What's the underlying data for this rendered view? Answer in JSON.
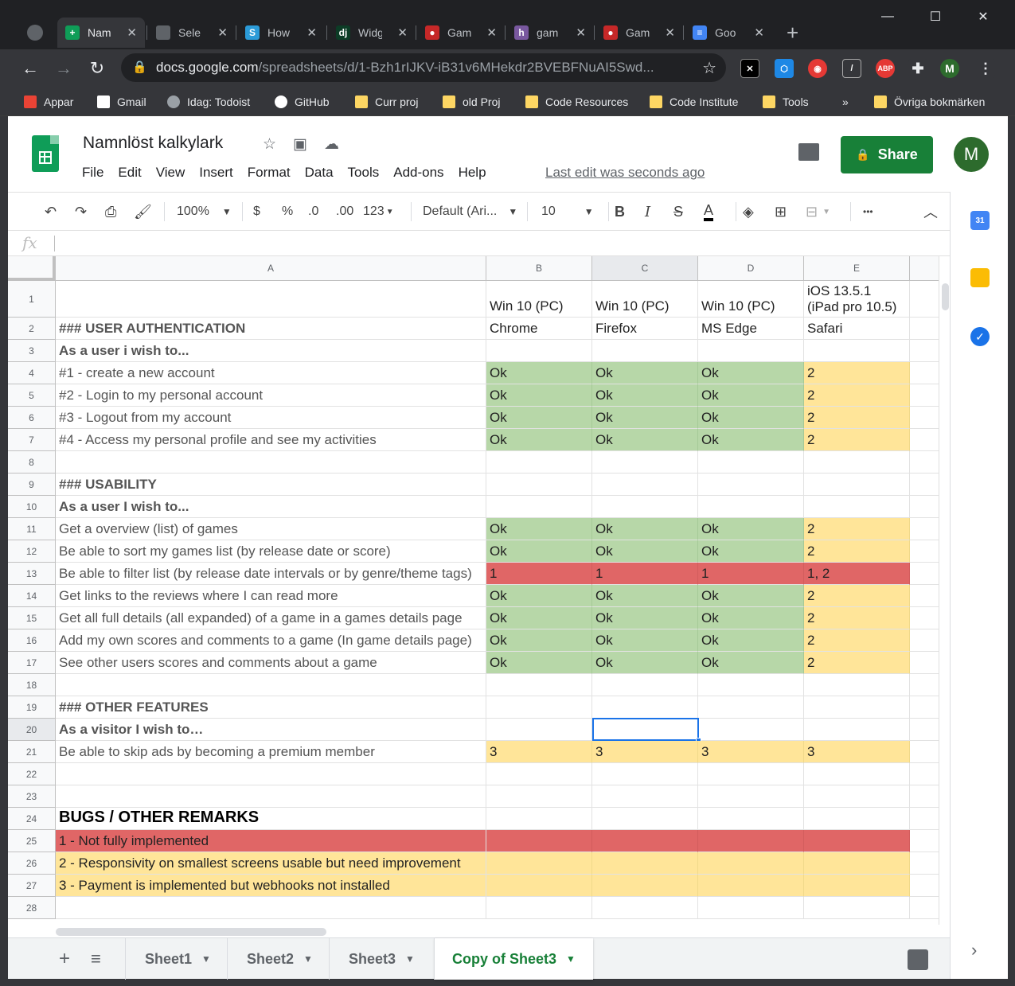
{
  "browser": {
    "tabs": [
      {
        "title": "Nam",
        "fav": "sheets-favicon-icon",
        "color": "#0f9d58",
        "glyph": "+"
      },
      {
        "title": "Sele",
        "fav": "globe-favicon-icon",
        "color": "#5f6368",
        "glyph": ""
      },
      {
        "title": "How",
        "fav": "s-favicon-icon",
        "color": "#2b9bd8",
        "glyph": "S"
      },
      {
        "title": "Widg",
        "fav": "django-favicon-icon",
        "color": "#0c3c26",
        "glyph": "dj"
      },
      {
        "title": "Gam",
        "fav": "pokeball-favicon-icon",
        "color": "#c62828",
        "glyph": "●"
      },
      {
        "title": "gam",
        "fav": "heroku-favicon-icon",
        "color": "#79589f",
        "glyph": "h"
      },
      {
        "title": "Gam",
        "fav": "pokeball-favicon-icon",
        "color": "#c62828",
        "glyph": "●"
      },
      {
        "title": "Goo",
        "fav": "docs-favicon-icon",
        "color": "#4285f4",
        "glyph": "≡"
      }
    ],
    "url_host": "docs.google.com",
    "url_path": "/spreadsheets/d/1-Bzh1rIJKV-iB31v6MHekdr2BVEBFNuAI5Swd...",
    "profile_initial": "M",
    "bookmarks": [
      {
        "label": "Appar",
        "icon": "apps-grid-icon"
      },
      {
        "label": "Gmail",
        "icon": "gmail-icon"
      },
      {
        "label": "Idag: Todoist",
        "icon": "globe-icon"
      },
      {
        "label": "GitHub",
        "icon": "github-icon"
      },
      {
        "label": "Curr proj",
        "icon": "folder-icon"
      },
      {
        "label": "old Proj",
        "icon": "folder-icon"
      },
      {
        "label": "Code Resources",
        "icon": "folder-icon"
      },
      {
        "label": "Code Institute",
        "icon": "folder-icon"
      },
      {
        "label": "Tools",
        "icon": "folder-icon"
      }
    ],
    "bookmarks_overflow": "»",
    "other_bookmarks": "Övriga bokmärken"
  },
  "sheets": {
    "title": "Namnlöst kalkylark",
    "menu": [
      "File",
      "Edit",
      "View",
      "Insert",
      "Format",
      "Data",
      "Tools",
      "Add-ons",
      "Help"
    ],
    "last_edit": "Last edit was seconds ago",
    "share_label": "Share",
    "avatar_initial": "M",
    "accent": "#188038"
  },
  "toolbar": {
    "zoom": "100%",
    "currency": "$",
    "percent": "%",
    "dec_less": ".0",
    "dec_more": ".00",
    "format_more": "123",
    "font": "Default (Ari...",
    "font_size": "10",
    "bold": "B",
    "italic": "I",
    "strike": "S",
    "text_color": "A",
    "more": "•••"
  },
  "formula_bar": {
    "fx": "fx",
    "value": ""
  },
  "grid": {
    "columns": [
      "A",
      "B",
      "C",
      "D",
      "E"
    ],
    "selected_cell": "C20",
    "rows": [
      {
        "n": "1",
        "cells": [
          "",
          "Win 10 (PC)",
          "Win 10 (PC)",
          "Win 10 (PC)",
          "iOS 13.5.1 (iPad pro 10.5)"
        ],
        "fills": [
          "",
          "",
          "",
          "",
          ""
        ],
        "style": ""
      },
      {
        "n": "2",
        "cells": [
          "### USER AUTHENTICATION",
          "Chrome",
          "Firefox",
          "MS Edge",
          "Safari"
        ],
        "fills": [
          "",
          "",
          "",
          "",
          ""
        ],
        "style": "bold"
      },
      {
        "n": "3",
        "cells": [
          "As a user i wish to...",
          "",
          "",
          "",
          ""
        ],
        "fills": [
          "",
          "",
          "",
          "",
          ""
        ],
        "style": "bold"
      },
      {
        "n": "4",
        "cells": [
          "#1 - create a new account",
          "Ok",
          "Ok",
          "Ok",
          "2"
        ],
        "fills": [
          "",
          "green",
          "green",
          "green",
          "yellow"
        ],
        "style": "gray"
      },
      {
        "n": "5",
        "cells": [
          "#2 - Login to my personal account",
          "Ok",
          "Ok",
          "Ok",
          "2"
        ],
        "fills": [
          "",
          "green",
          "green",
          "green",
          "yellow"
        ],
        "style": "gray"
      },
      {
        "n": "6",
        "cells": [
          "#3 - Logout from my account",
          "Ok",
          "Ok",
          "Ok",
          "2"
        ],
        "fills": [
          "",
          "green",
          "green",
          "green",
          "yellow"
        ],
        "style": "gray"
      },
      {
        "n": "7",
        "cells": [
          "#4  - Access my personal profile and see my activities",
          "Ok",
          "Ok",
          "Ok",
          "2"
        ],
        "fills": [
          "",
          "green",
          "green",
          "green",
          "yellow"
        ],
        "style": "gray"
      },
      {
        "n": "8",
        "cells": [
          "",
          "",
          "",
          "",
          ""
        ],
        "fills": [
          "",
          "",
          "",
          "",
          ""
        ],
        "style": ""
      },
      {
        "n": "9",
        "cells": [
          "### USABILITY",
          "",
          "",
          "",
          ""
        ],
        "fills": [
          "",
          "",
          "",
          "",
          ""
        ],
        "style": "bold"
      },
      {
        "n": "10",
        "cells": [
          "As a user I wish to...",
          "",
          "",
          "",
          ""
        ],
        "fills": [
          "",
          "",
          "",
          "",
          ""
        ],
        "style": "bold"
      },
      {
        "n": "11",
        "cells": [
          "Get a overview (list) of games",
          "Ok",
          "Ok",
          "Ok",
          "2"
        ],
        "fills": [
          "",
          "green",
          "green",
          "green",
          "yellow"
        ],
        "style": "gray"
      },
      {
        "n": "12",
        "cells": [
          "Be able to sort my games list (by release date or score)",
          "Ok",
          "Ok",
          "Ok",
          "2"
        ],
        "fills": [
          "",
          "green",
          "green",
          "green",
          "yellow"
        ],
        "style": "gray"
      },
      {
        "n": "13",
        "cells": [
          "Be able to filter list (by release date intervals or by genre/theme tags)",
          "1",
          "1",
          "1",
          "1, 2"
        ],
        "fills": [
          "",
          "red",
          "red",
          "red",
          "red"
        ],
        "style": "gray"
      },
      {
        "n": "14",
        "cells": [
          "Get links to the reviews where I can read more",
          "Ok",
          "Ok",
          "Ok",
          "2"
        ],
        "fills": [
          "",
          "green",
          "green",
          "green",
          "yellow"
        ],
        "style": "gray"
      },
      {
        "n": "15",
        "cells": [
          "Get all full details (all expanded) of a game in a games details page",
          "Ok",
          "Ok",
          "Ok",
          "2"
        ],
        "fills": [
          "",
          "green",
          "green",
          "green",
          "yellow"
        ],
        "style": "gray"
      },
      {
        "n": "16",
        "cells": [
          "Add my own scores and comments to a game (In game details page)",
          "Ok",
          "Ok",
          "Ok",
          "2"
        ],
        "fills": [
          "",
          "green",
          "green",
          "green",
          "yellow"
        ],
        "style": "gray"
      },
      {
        "n": "17",
        "cells": [
          "See other users scores and comments about a game",
          "Ok",
          "Ok",
          "Ok",
          "2"
        ],
        "fills": [
          "",
          "green",
          "green",
          "green",
          "yellow"
        ],
        "style": "gray"
      },
      {
        "n": "18",
        "cells": [
          "",
          "",
          "",
          "",
          ""
        ],
        "fills": [
          "",
          "",
          "",
          "",
          ""
        ],
        "style": ""
      },
      {
        "n": "19",
        "cells": [
          "### OTHER FEATURES",
          "",
          "",
          "",
          ""
        ],
        "fills": [
          "",
          "",
          "",
          "",
          ""
        ],
        "style": "bold"
      },
      {
        "n": "20",
        "cells": [
          "As a visitor I wish to…",
          "",
          "",
          "",
          ""
        ],
        "fills": [
          "",
          "",
          "",
          "",
          ""
        ],
        "style": "bold"
      },
      {
        "n": "21",
        "cells": [
          "Be able to skip ads by becoming a premium member",
          "3",
          "3",
          "3",
          "3"
        ],
        "fills": [
          "",
          "yellow",
          "yellow",
          "yellow",
          "yellow"
        ],
        "style": "gray"
      },
      {
        "n": "22",
        "cells": [
          "",
          "",
          "",
          "",
          ""
        ],
        "fills": [
          "",
          "",
          "",
          "",
          ""
        ],
        "style": ""
      },
      {
        "n": "23",
        "cells": [
          "",
          "",
          "",
          "",
          ""
        ],
        "fills": [
          "",
          "",
          "",
          "",
          ""
        ],
        "style": ""
      },
      {
        "n": "24",
        "cells": [
          "BUGS / OTHER REMARKS",
          "",
          "",
          "",
          ""
        ],
        "fills": [
          "",
          "",
          "",
          "",
          ""
        ],
        "style": "big"
      },
      {
        "n": "25",
        "cells": [
          "1 - Not fully implemented",
          "",
          "",
          "",
          ""
        ],
        "fills": [
          "red",
          "red",
          "red",
          "red",
          "red"
        ],
        "style": "black"
      },
      {
        "n": "26",
        "cells": [
          "2 - Responsivity on smallest screens usable but need improvement",
          "",
          "",
          "",
          ""
        ],
        "fills": [
          "yellow",
          "yellow",
          "yellow",
          "yellow",
          "yellow"
        ],
        "style": "black"
      },
      {
        "n": "27",
        "cells": [
          "3 - Payment is implemented but  webhooks not installed",
          "",
          "",
          "",
          ""
        ],
        "fills": [
          "yellow",
          "yellow",
          "yellow",
          "yellow",
          "yellow"
        ],
        "style": "black"
      },
      {
        "n": "28",
        "cells": [
          "",
          "",
          "",
          "",
          ""
        ],
        "fills": [
          "",
          "",
          "",
          "",
          ""
        ],
        "style": ""
      }
    ]
  },
  "sheet_tabs": {
    "add": "+",
    "list": "≡",
    "tabs": [
      "Sheet1",
      "Sheet2",
      "Sheet3",
      "Copy of Sheet3"
    ],
    "active": "Copy of Sheet3"
  },
  "colors": {
    "green_fill": "#b7d7a8",
    "yellow_fill": "#ffe599",
    "red_fill": "#e06666",
    "selection": "#1a73e8"
  }
}
